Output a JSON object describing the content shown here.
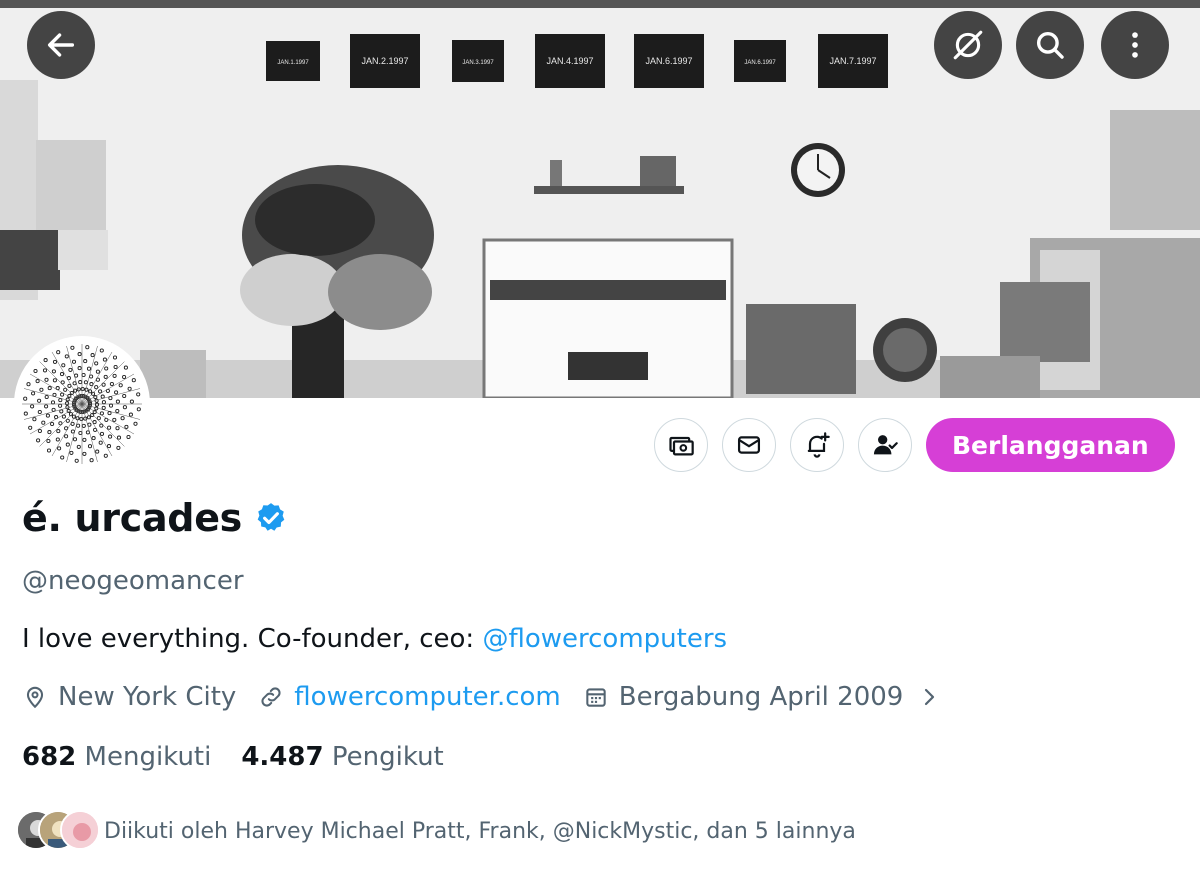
{
  "header": {
    "back_icon": "arrow-left-icon",
    "grok_icon": "circle-slash-icon",
    "search_icon": "search-icon",
    "more_icon": "more-vertical-icon",
    "banner_labels": [
      "JAN.1.1997",
      "JAN.2.1997",
      "JAN.3.1997",
      "JAN.4.1997",
      "JAN.6.1997",
      "JAN.6.1997",
      "JAN.7.1997"
    ]
  },
  "actions": {
    "tip_icon": "money-icon",
    "message_icon": "envelope-icon",
    "notify_icon": "bell-plus-icon",
    "following_icon": "person-check-icon",
    "subscribe_label": "Berlangganan",
    "subscribe_color": "#d63fd6"
  },
  "profile": {
    "name": "é. urcades",
    "verified_color": "#1d9bf0",
    "handle": "@neogeomancer",
    "bio_text": "I love everything. Co-founder, ceo: ",
    "bio_mention": "@flowercomputers",
    "location": "New York City",
    "website": "flowercomputer.com",
    "joined": "Bergabung April 2009",
    "following_count": "682",
    "following_label": "Mengikuti",
    "followers_count": "4.487",
    "followers_label": "Pengikut",
    "followed_by": "Diikuti oleh Harvey Michael Pratt, Frank, @NickMystic, dan 5 lainnya"
  },
  "colors": {
    "link": "#1d9bf0",
    "secondary_text": "#536471",
    "primary_text": "#0f1419"
  }
}
